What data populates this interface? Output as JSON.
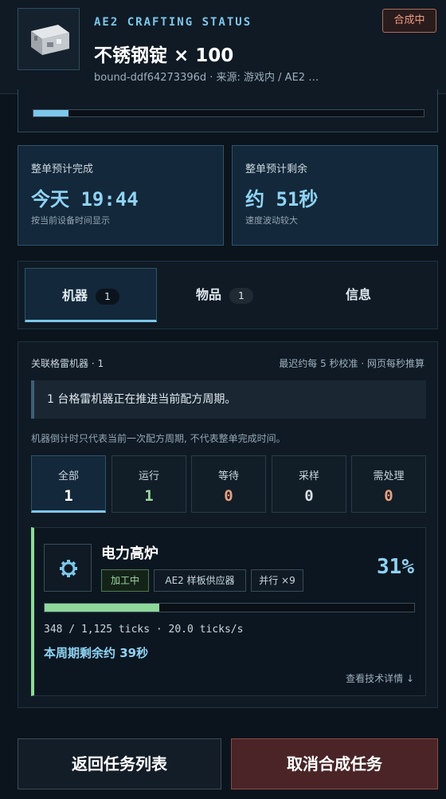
{
  "header": {
    "subtitle": "AE2 CRAFTING STATUS",
    "title": "不锈钢锭 × 100",
    "meta": "bound-ddf64273396d · 来源: 游戏内 / AE2 …",
    "status": "合成中",
    "thumbnail_icon": "stainless-steel-ingot-icon"
  },
  "progress": {
    "fraction": 0.09
  },
  "eta": {
    "complete": {
      "label": "整单预计完成",
      "value": "今天  19:44",
      "note": "按当前设备时间显示"
    },
    "remaining": {
      "label": "整单预计剩余",
      "value": "约  51秒",
      "note": "速度波动较大"
    }
  },
  "tabs": [
    {
      "label": "机器",
      "count": "1"
    },
    {
      "label": "物品",
      "count": "1"
    },
    {
      "label": "信息"
    }
  ],
  "machines": {
    "header_left": "关联格雷机器 · 1",
    "header_right": "最迟约每 5 秒校准 · 网页每秒推算",
    "notice": "1 台格雷机器正在推进当前配方周期。",
    "disclaimer": "机器倒计时只代表当前一次配方周期, 不代表整单完成时间。",
    "filters": [
      {
        "label": "全部",
        "count": "1"
      },
      {
        "label": "运行",
        "count": "1"
      },
      {
        "label": "等待",
        "count": "0"
      },
      {
        "label": "采样",
        "count": "0"
      },
      {
        "label": "需处理",
        "count": "0"
      }
    ],
    "colors": {
      "white": "#ffffff",
      "running": "#9bd7a2",
      "warn": "#e9a17a",
      "neutral": "#d7dee4"
    },
    "card": {
      "icon": "gear-icon",
      "name": "电力高炉",
      "percent": "31%",
      "progress": 0.31,
      "chips": [
        "加工中",
        "AE2 样板供应器",
        "并行 ×9"
      ],
      "ticks": "348 / 1,125 ticks · 20.0 ticks/s",
      "remaining": "本周期剩余约  39秒",
      "details": "查看技术详情 ↓"
    }
  },
  "buttons": {
    "back": "返回任务列表",
    "cancel": "取消合成任务"
  }
}
